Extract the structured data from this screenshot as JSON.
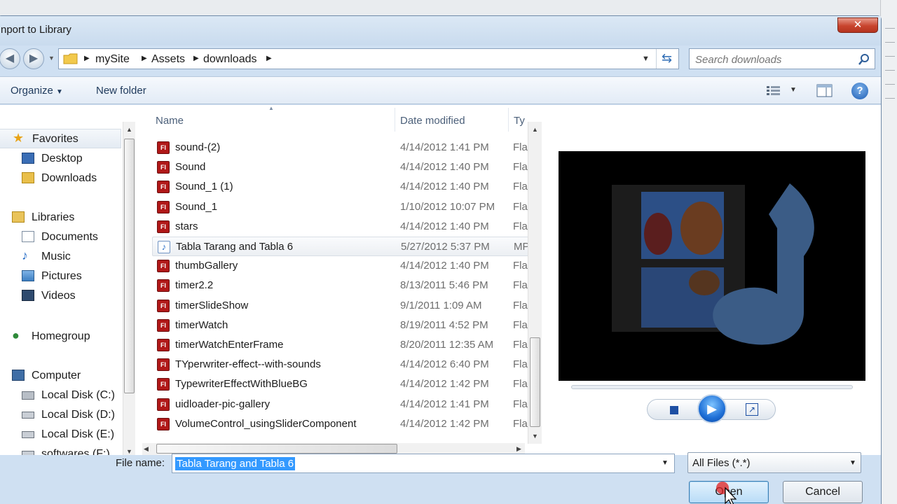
{
  "window": {
    "title": "nport to Library",
    "close_glyph": "✕"
  },
  "address_bar": {
    "crumbs": [
      "mySite",
      "Assets",
      "downloads"
    ],
    "search_placeholder": "Search downloads"
  },
  "toolbar": {
    "organize_label": "Organize",
    "new_folder_label": "New folder"
  },
  "sidebar": {
    "favorites": {
      "label": "Favorites",
      "items": [
        "Desktop",
        "Downloads"
      ]
    },
    "libraries": {
      "label": "Libraries",
      "items": [
        "Documents",
        "Music",
        "Pictures",
        "Videos"
      ]
    },
    "homegroup": {
      "label": "Homegroup"
    },
    "computer": {
      "label": "Computer",
      "items": [
        "Local Disk (C:)",
        "Local Disk (D:)",
        "Local Disk (E:)",
        "softwares (F:)"
      ]
    }
  },
  "file_list": {
    "columns": {
      "name": "Name",
      "date": "Date modified",
      "type": "Ty"
    },
    "rows": [
      {
        "name": "sound-(2)",
        "date": "4/14/2012 1:41 PM",
        "type": "Fla",
        "icon": "flash-file-icon"
      },
      {
        "name": "Sound",
        "date": "4/14/2012 1:40 PM",
        "type": "Fla",
        "icon": "flash-file-icon"
      },
      {
        "name": "Sound_1 (1)",
        "date": "4/14/2012 1:40 PM",
        "type": "Fla",
        "icon": "flash-file-icon"
      },
      {
        "name": "Sound_1",
        "date": "1/10/2012 10:07 PM",
        "type": "Fla",
        "icon": "flash-file-icon"
      },
      {
        "name": "stars",
        "date": "4/14/2012 1:40 PM",
        "type": "Fla",
        "icon": "flash-file-icon"
      },
      {
        "name": "Tabla Tarang and Tabla 6",
        "date": "5/27/2012 5:37 PM",
        "type": "MP",
        "icon": "music-file-icon",
        "selected": true
      },
      {
        "name": "thumbGallery",
        "date": "4/14/2012 1:40 PM",
        "type": "Fla",
        "icon": "flash-file-icon"
      },
      {
        "name": "timer2.2",
        "date": "8/13/2011 5:46 PM",
        "type": "Fla",
        "icon": "flash-file-icon"
      },
      {
        "name": "timerSlideShow",
        "date": "9/1/2011 1:09 AM",
        "type": "Fla",
        "icon": "flash-file-icon"
      },
      {
        "name": "timerWatch",
        "date": "8/19/2011 4:52 PM",
        "type": "Fla",
        "icon": "flash-file-icon"
      },
      {
        "name": "timerWatchEnterFrame",
        "date": "8/20/2011 12:35 AM",
        "type": "Fla",
        "icon": "flash-file-icon"
      },
      {
        "name": "TYperwriter-effect--with-sounds",
        "date": "4/14/2012 6:40 PM",
        "type": "Fla",
        "icon": "flash-file-icon"
      },
      {
        "name": "TypewriterEffectWithBlueBG",
        "date": "4/14/2012 1:42 PM",
        "type": "Fla",
        "icon": "flash-file-icon"
      },
      {
        "name": "uidloader-pic-gallery",
        "date": "4/14/2012 1:41 PM",
        "type": "Fla",
        "icon": "flash-file-icon"
      },
      {
        "name": "VolumeControl_usingSliderComponent",
        "date": "4/14/2012 1:42 PM",
        "type": "Fla",
        "icon": "flash-file-icon"
      }
    ]
  },
  "bottom": {
    "file_name_label": "File name:",
    "file_name_value": "Tabla Tarang and Tabla 6",
    "file_type_value": "All Files (*.*)",
    "open_label": "Open",
    "cancel_label": "Cancel"
  },
  "colors": {
    "accent": "#3399ff",
    "flash_icon": "#b01818",
    "titlebar": "#c9dbee"
  }
}
